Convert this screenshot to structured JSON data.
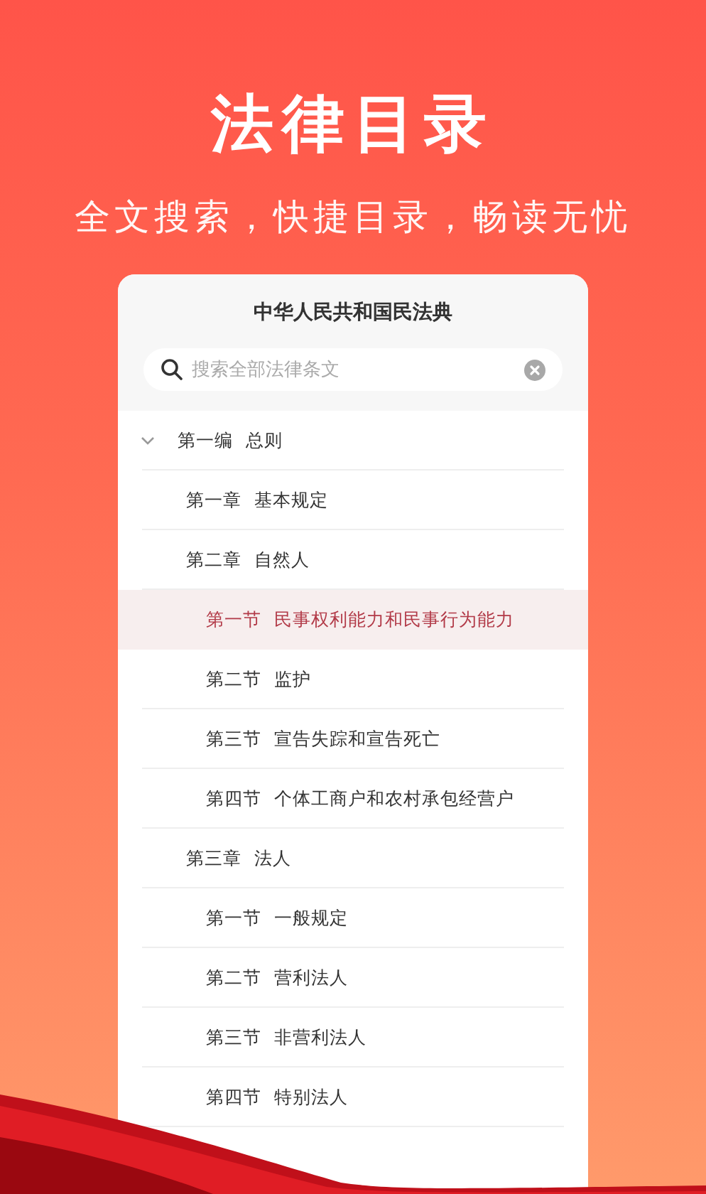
{
  "headline": "法律目录",
  "tagline": "全文搜索，快捷目录，畅读无忧",
  "book": {
    "title": "中华人民共和国民法典",
    "search": {
      "placeholder": "搜索全部法律条文"
    },
    "outline": [
      {
        "number": "第一编",
        "title": "总则",
        "expanded": true,
        "selected": false,
        "children": [
          {
            "number": "第一章",
            "title": "基本规定",
            "selected": false
          },
          {
            "number": "第二章",
            "title": "自然人",
            "selected": false,
            "children": [
              {
                "number": "第一节",
                "title": "民事权利能力和民事行为能力",
                "selected": true
              },
              {
                "number": "第二节",
                "title": "监护",
                "selected": false
              },
              {
                "number": "第三节",
                "title": "宣告失踪和宣告死亡",
                "selected": false
              },
              {
                "number": "第四节",
                "title": "个体工商户和农村承包经营户",
                "selected": false
              }
            ]
          },
          {
            "number": "第三章",
            "title": "法人",
            "selected": false,
            "children": [
              {
                "number": "第一节",
                "title": "一般规定",
                "selected": false
              },
              {
                "number": "第二节",
                "title": "营利法人",
                "selected": false
              },
              {
                "number": "第三节",
                "title": "非营利法人",
                "selected": false
              },
              {
                "number": "第四节",
                "title": "特别法人",
                "selected": false
              }
            ]
          }
        ]
      }
    ]
  }
}
